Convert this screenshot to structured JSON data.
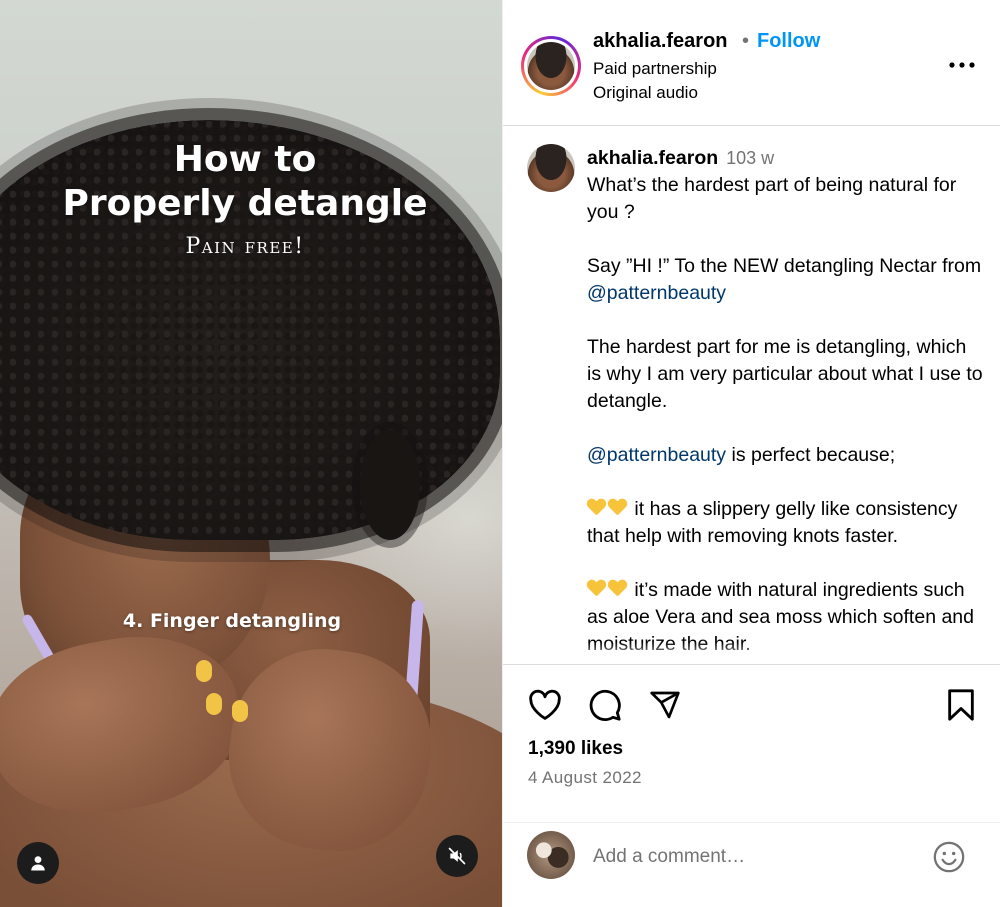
{
  "media": {
    "title_line1": "How to",
    "title_line2": "Properly detangle",
    "subtitle": "Pain free!",
    "step_text": "4. Finger detangling",
    "icons": {
      "user": "user-icon",
      "mute": "muted-speaker-icon"
    }
  },
  "header": {
    "username": "akhalia.fearon",
    "separator": "•",
    "follow_label": "Follow",
    "line1": "Paid partnership",
    "line2": "Original audio",
    "more_icon": "more-options-icon"
  },
  "caption": {
    "username": "akhalia.fearon",
    "time_ago": "103 w",
    "p1": "What’s the hardest part of being natural for you ?",
    "p2_a": "Say ”HI !” To the NEW detangling Nectar from ",
    "p2_mention": "@patternbeauty",
    "p3": "The hardest part for me is detangling, which is why I am very particular about what I use to detangle.",
    "p4_mention": "@patternbeauty",
    "p4_b": " is perfect because;",
    "p5": " it has a slippery gelly like consistency that help with removing knots faster.",
    "p6": " it’s made with natural ingredients such as aloe Vera and sea moss which soften and moisturize the hair."
  },
  "actions": {
    "icons": [
      "heart-icon",
      "comment-icon",
      "share-icon",
      "bookmark-icon"
    ],
    "likes": "1,390 likes",
    "date": "4 August 2022"
  },
  "comment": {
    "placeholder": "Add a comment…",
    "emoji_icon": "smiley-icon"
  },
  "colors": {
    "follow_blue": "#0095f6",
    "mention_blue": "#00376b",
    "secondary_text": "#737373",
    "divider": "#dbdbdb"
  }
}
